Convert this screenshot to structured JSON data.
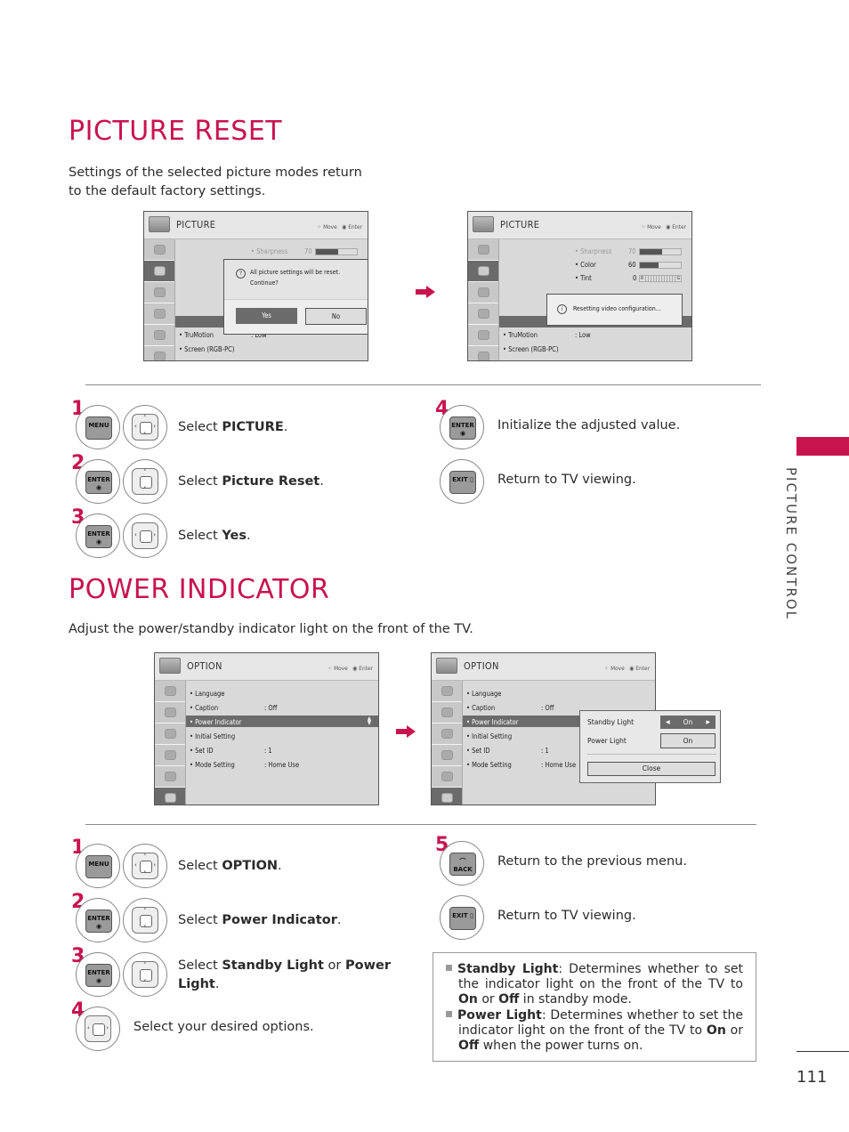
{
  "page_number": "111",
  "side_tab": {
    "label": "PICTURE CONTROL",
    "accent": "#c8134f"
  },
  "picture_reset": {
    "title": "PICTURE RESET",
    "description_lines": [
      "Settings of the selected picture modes return",
      "to the default factory settings."
    ],
    "screen1": {
      "title": "PICTURE",
      "hint_move": "Move",
      "hint_enter": "Enter",
      "items": {
        "sharpness": "• Sharpness",
        "sharpness_val": "70",
        "trumotion": "• TruMotion",
        "trumotion_val": ": Low",
        "screen": "• Screen (RGB-PC)"
      },
      "dialog": {
        "message_line1": "All picture settings will be reset.",
        "message_line2": "Continue?",
        "yes": "Yes",
        "no": "No"
      }
    },
    "screen2": {
      "title": "PICTURE",
      "hint_move": "Move",
      "hint_enter": "Enter",
      "items": {
        "sharpness": "• Sharpness",
        "sharpness_val": "70",
        "sharpness_level": 0.55,
        "color": "• Color",
        "color_val": "60",
        "color_level": 0.45,
        "tint": "• Tint",
        "tint_val": "0",
        "tint_left": "R",
        "tint_right": "G",
        "trumotion": "• TruMotion",
        "trumotion_val": ": Low",
        "screen": "• Screen (RGB-PC)"
      },
      "toast": "Resetting video configuration..."
    },
    "steps": [
      {
        "num": "1",
        "key": "MENU",
        "pad": "4way",
        "pre": "Select ",
        "bold": "PICTURE",
        "post": "."
      },
      {
        "num": "2",
        "key": "ENTER",
        "pad": "updown",
        "pre": "Select ",
        "bold": "Picture Reset",
        "post": "."
      },
      {
        "num": "3",
        "key": "ENTER",
        "pad": "leftright",
        "pre": "Select ",
        "bold": "Yes",
        "post": "."
      },
      {
        "num": "4",
        "key": "ENTER",
        "text": "Initialize the adjusted value."
      },
      {
        "num": "",
        "key": "EXIT",
        "text": "Return to TV viewing."
      }
    ]
  },
  "power_indicator": {
    "title": "POWER INDICATOR",
    "description": "Adjust the power/standby indicator light on the front of the TV.",
    "screen1": {
      "title": "OPTION",
      "hint_move": "Move",
      "hint_enter": "Enter",
      "items": [
        {
          "label": "• Language",
          "value": ""
        },
        {
          "label": "• Caption",
          "value": ": Off"
        },
        {
          "label": "• Power Indicator",
          "value": "",
          "selected": true
        },
        {
          "label": "• Initial Setting",
          "value": ""
        },
        {
          "label": "• Set ID",
          "value": ": 1"
        },
        {
          "label": "• Mode Setting",
          "value": ": Home Use"
        }
      ]
    },
    "screen2": {
      "title": "OPTION",
      "hint_move": "Move",
      "hint_enter": "Enter",
      "items": [
        {
          "label": "• Language",
          "value": ""
        },
        {
          "label": "• Caption",
          "value": ": Off"
        },
        {
          "label": "• Power Indicator",
          "value": "",
          "selected": true
        },
        {
          "label": "• Initial Setting",
          "value": ""
        },
        {
          "label": "• Set ID",
          "value": ": 1"
        },
        {
          "label": "• Mode Setting",
          "value": ": Home Use"
        }
      ],
      "popup": {
        "standby_label": "Standby Light",
        "standby_value": "On",
        "power_label": "Power Light",
        "power_value": "On",
        "close": "Close"
      }
    },
    "steps": [
      {
        "num": "1",
        "key": "MENU",
        "pre": "Select ",
        "bold": "OPTION",
        "post": "."
      },
      {
        "num": "2",
        "key": "ENTER",
        "pre": "Select ",
        "bold": "Power Indicator",
        "post": "."
      },
      {
        "num": "3",
        "key": "ENTER",
        "pre": "Select ",
        "bold": "Standby Light",
        "mid": " or ",
        "bold2": "Power",
        "line2bold": "Light",
        "post": "."
      },
      {
        "num": "4",
        "text": "Select your desired options."
      },
      {
        "num": "5",
        "key": "BACK",
        "text": "Return to the previous menu."
      },
      {
        "num": "",
        "key": "EXIT",
        "text": "Return to TV viewing."
      }
    ],
    "notes": [
      {
        "bold": "Standby Light",
        "text": ": Determines whether to set the indicator light on the front of the TV to ",
        "b2": "On",
        "t2": " or ",
        "b3": "Off",
        "t3": " in standby mode."
      },
      {
        "bold": "Power Light",
        "text": ": Determines whether to set the indicator light on the front of the TV to ",
        "b2": "On",
        "t2": " or ",
        "b3": "Off",
        "t3": " when the power turns on."
      }
    ]
  }
}
